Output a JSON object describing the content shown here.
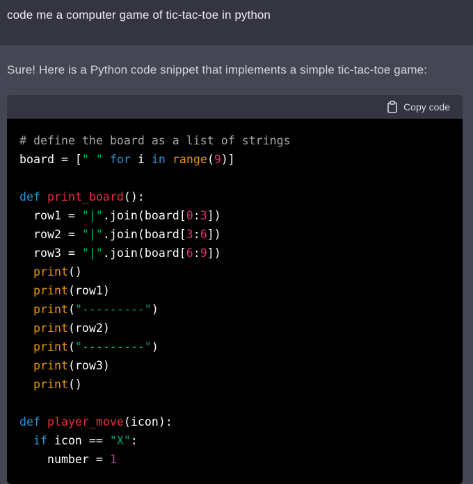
{
  "user_message": "code me a computer game of tic-tac-toe in python",
  "assistant_message": "Sure! Here is a Python code snippet that implements a simple tic-tac-toe game:",
  "code_block": {
    "copy_label": "Copy code",
    "copy_icon": "clipboard-icon",
    "colors": {
      "comment": "#a3a3a3",
      "plain": "#ffffff",
      "string": "#00a67d",
      "keyword": "#2e95d3",
      "builtin": "#e9950c",
      "number": "#df3079",
      "function": "#f22c3d"
    },
    "lines": [
      [
        {
          "t": "comment",
          "v": "# define the board as a list of strings"
        }
      ],
      [
        {
          "t": "plain",
          "v": "board = ["
        },
        {
          "t": "string",
          "v": "\" \""
        },
        {
          "t": "plain",
          "v": " "
        },
        {
          "t": "keyword",
          "v": "for"
        },
        {
          "t": "plain",
          "v": " i "
        },
        {
          "t": "keyword",
          "v": "in"
        },
        {
          "t": "plain",
          "v": " "
        },
        {
          "t": "builtin",
          "v": "range"
        },
        {
          "t": "plain",
          "v": "("
        },
        {
          "t": "number",
          "v": "9"
        },
        {
          "t": "plain",
          "v": ")]"
        }
      ],
      [],
      [
        {
          "t": "keyword",
          "v": "def"
        },
        {
          "t": "plain",
          "v": " "
        },
        {
          "t": "func",
          "v": "print_board"
        },
        {
          "t": "plain",
          "v": "():"
        }
      ],
      [
        {
          "t": "plain",
          "v": "  row1 = "
        },
        {
          "t": "string",
          "v": "\"|\""
        },
        {
          "t": "plain",
          "v": ".join(board["
        },
        {
          "t": "number",
          "v": "0"
        },
        {
          "t": "plain",
          "v": ":"
        },
        {
          "t": "number",
          "v": "3"
        },
        {
          "t": "plain",
          "v": "])"
        }
      ],
      [
        {
          "t": "plain",
          "v": "  row2 = "
        },
        {
          "t": "string",
          "v": "\"|\""
        },
        {
          "t": "plain",
          "v": ".join(board["
        },
        {
          "t": "number",
          "v": "3"
        },
        {
          "t": "plain",
          "v": ":"
        },
        {
          "t": "number",
          "v": "6"
        },
        {
          "t": "plain",
          "v": "])"
        }
      ],
      [
        {
          "t": "plain",
          "v": "  row3 = "
        },
        {
          "t": "string",
          "v": "\"|\""
        },
        {
          "t": "plain",
          "v": ".join(board["
        },
        {
          "t": "number",
          "v": "6"
        },
        {
          "t": "plain",
          "v": ":"
        },
        {
          "t": "number",
          "v": "9"
        },
        {
          "t": "plain",
          "v": "])"
        }
      ],
      [
        {
          "t": "plain",
          "v": "  "
        },
        {
          "t": "builtin",
          "v": "print"
        },
        {
          "t": "plain",
          "v": "()"
        }
      ],
      [
        {
          "t": "plain",
          "v": "  "
        },
        {
          "t": "builtin",
          "v": "print"
        },
        {
          "t": "plain",
          "v": "(row1)"
        }
      ],
      [
        {
          "t": "plain",
          "v": "  "
        },
        {
          "t": "builtin",
          "v": "print"
        },
        {
          "t": "plain",
          "v": "("
        },
        {
          "t": "string",
          "v": "\"---------\""
        },
        {
          "t": "plain",
          "v": ")"
        }
      ],
      [
        {
          "t": "plain",
          "v": "  "
        },
        {
          "t": "builtin",
          "v": "print"
        },
        {
          "t": "plain",
          "v": "(row2)"
        }
      ],
      [
        {
          "t": "plain",
          "v": "  "
        },
        {
          "t": "builtin",
          "v": "print"
        },
        {
          "t": "plain",
          "v": "("
        },
        {
          "t": "string",
          "v": "\"---------\""
        },
        {
          "t": "plain",
          "v": ")"
        }
      ],
      [
        {
          "t": "plain",
          "v": "  "
        },
        {
          "t": "builtin",
          "v": "print"
        },
        {
          "t": "plain",
          "v": "(row3)"
        }
      ],
      [
        {
          "t": "plain",
          "v": "  "
        },
        {
          "t": "builtin",
          "v": "print"
        },
        {
          "t": "plain",
          "v": "()"
        }
      ],
      [],
      [
        {
          "t": "keyword",
          "v": "def"
        },
        {
          "t": "plain",
          "v": " "
        },
        {
          "t": "func",
          "v": "player_move"
        },
        {
          "t": "plain",
          "v": "(icon):"
        }
      ],
      [
        {
          "t": "plain",
          "v": "  "
        },
        {
          "t": "keyword",
          "v": "if"
        },
        {
          "t": "plain",
          "v": " icon == "
        },
        {
          "t": "string",
          "v": "\"X\""
        },
        {
          "t": "plain",
          "v": ":"
        }
      ],
      [
        {
          "t": "plain",
          "v": "    number = "
        },
        {
          "t": "number",
          "v": "1"
        }
      ]
    ]
  }
}
